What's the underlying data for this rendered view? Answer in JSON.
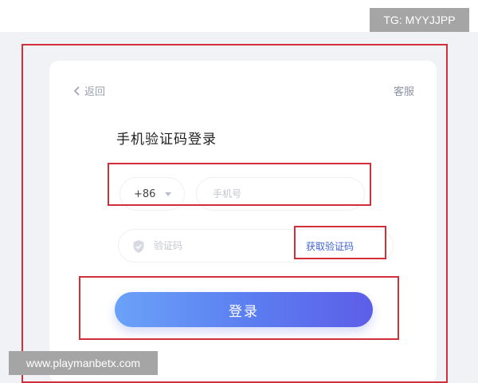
{
  "overlay": {
    "top_tag": "TG: MYYJJPP",
    "bottom_tag": "www.playmanbetx.com"
  },
  "header": {
    "back_label": "返回",
    "service_label": "客服"
  },
  "form": {
    "title": "手机验证码登录",
    "country_code": "+86",
    "phone_placeholder": "手机号",
    "code_placeholder": "验证码",
    "get_code_label": "获取验证码",
    "login_label": "登录"
  },
  "colors": {
    "accent": "#3f62d9",
    "button_gradient_start": "#6aa2f8",
    "button_gradient_end": "#5d5ee8",
    "annotation_red": "#d1303a"
  }
}
